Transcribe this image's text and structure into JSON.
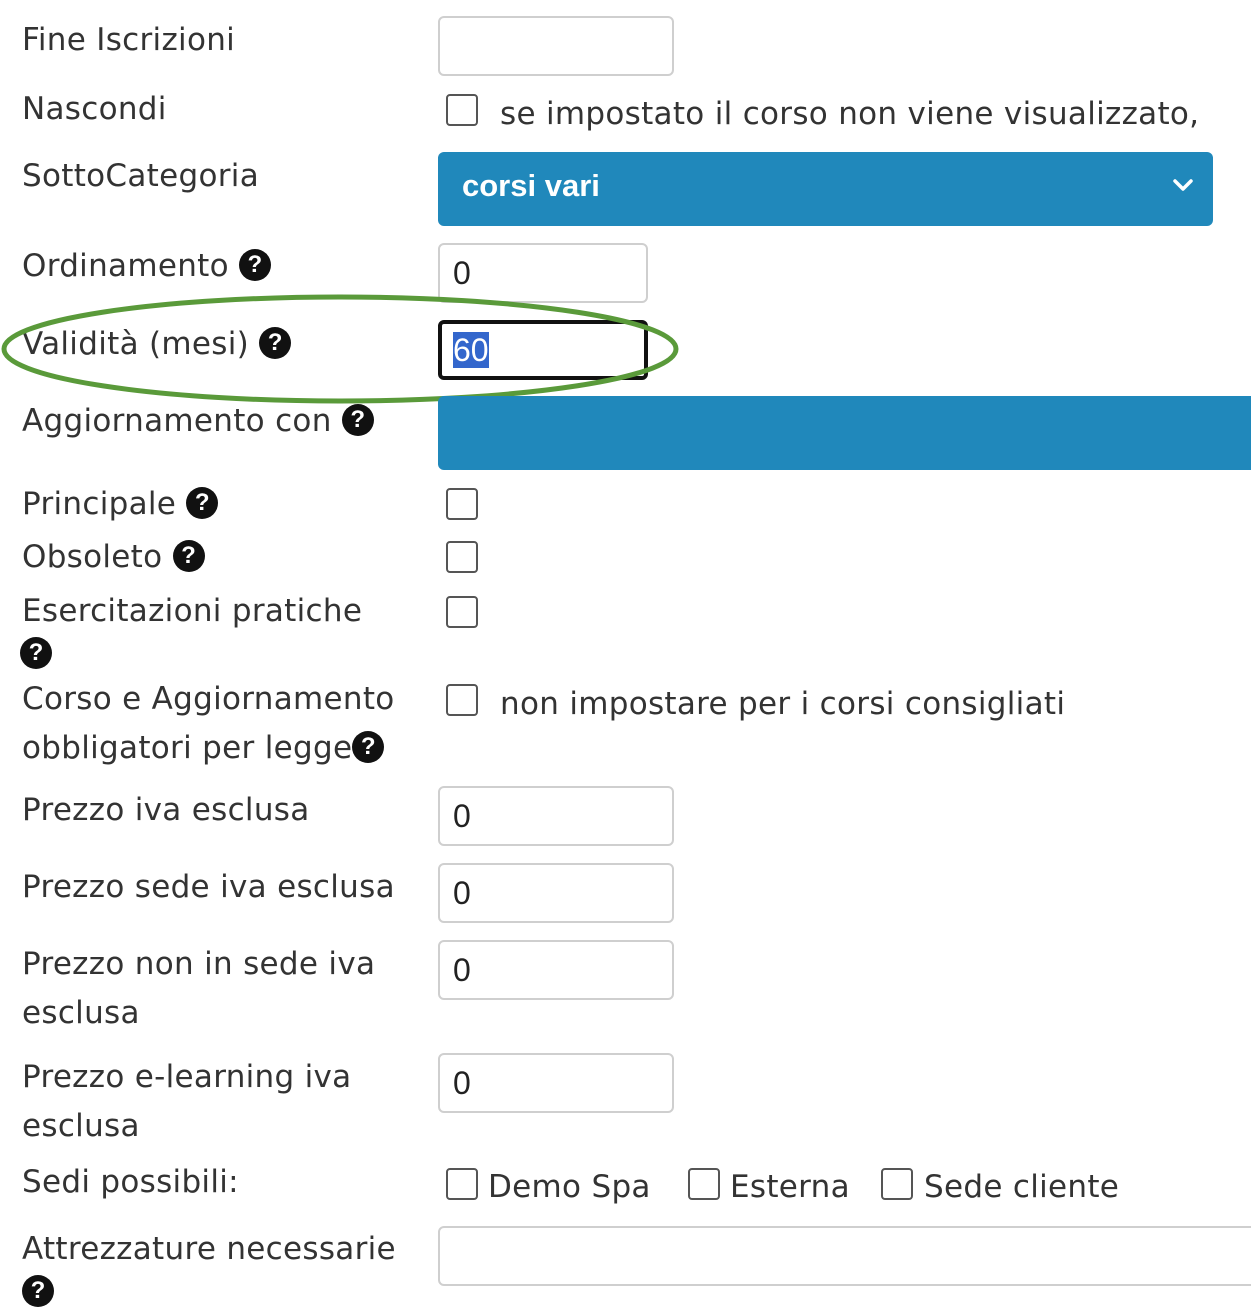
{
  "labels": {
    "fine_iscrizioni": "Fine Iscrizioni",
    "nascondi": "Nascondi",
    "sottocategoria": "SottoCategoria",
    "ordinamento": "Ordinamento",
    "validita": "Validità (mesi)",
    "aggiornamento": "Aggiornamento con",
    "principale": "Principale",
    "obsoleto": "Obsoleto",
    "esercitazioni": "Esercitazioni pratiche",
    "corso_aggiornamento_1": "Corso e Aggiornamento",
    "corso_aggiornamento_2": "obbligatori per legge",
    "prezzo_iva": "Prezzo iva esclusa",
    "prezzo_sede": "Prezzo sede iva esclusa",
    "prezzo_non_sede_1": "Prezzo non in sede iva",
    "prezzo_non_sede_2": "esclusa",
    "prezzo_elearning_1": "Prezzo e-learning iva",
    "prezzo_elearning_2": "esclusa",
    "sedi": "Sedi possibili:",
    "attrezzature": "Attrezzature necessarie"
  },
  "values": {
    "fine_iscrizioni": "",
    "ordinamento": "0",
    "validita": "60",
    "prezzo_iva": "0",
    "prezzo_sede": "0",
    "prezzo_non_sede": "0",
    "prezzo_elearning": "0",
    "attrezzature": ""
  },
  "select": {
    "sottocategoria": "corsi vari",
    "aggiornamento": ""
  },
  "notes": {
    "nascondi": "se impostato il corso non viene visualizzato,",
    "corso_aggiornamento": "non impostare per i corsi consigliati"
  },
  "sedi_options": [
    "Demo Spa",
    "Esterna",
    "Sede cliente"
  ],
  "help_icon_glyph": "?",
  "icons": {
    "help": "question-circle-icon",
    "dropdown": "chevron-down-icon"
  },
  "colors": {
    "select_bg": "#2088bb",
    "highlight_ellipse": "#5a9a3a",
    "selection": "#3366cc"
  }
}
